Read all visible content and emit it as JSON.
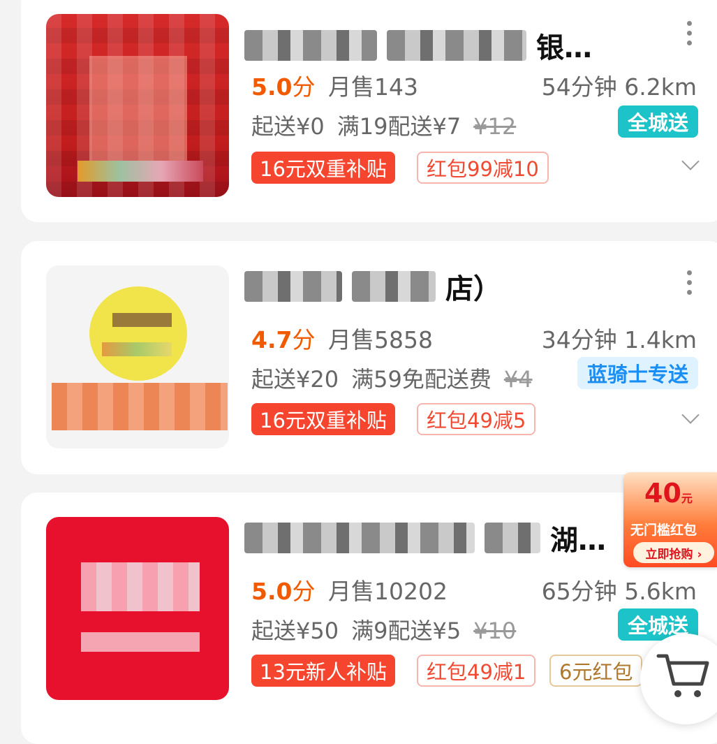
{
  "stores": [
    {
      "name_suffix": "银…",
      "score": "5.0",
      "score_unit": "分",
      "sales": "月售143",
      "time_distance": "54分钟 6.2km",
      "min_order": "起送¥0",
      "delivery_fee": "满19配送¥7",
      "original_fee": "¥12",
      "delivery_tag": "全城送",
      "tags": [
        "16元双重补贴",
        "红包99减10"
      ]
    },
    {
      "name_suffix": "店）",
      "score": "4.7",
      "score_unit": "分",
      "sales": "月售5858",
      "time_distance": "34分钟 1.4km",
      "min_order": "起送¥20",
      "delivery_fee": "满59免配送费",
      "original_fee": "¥4",
      "delivery_tag": "蓝骑士专送",
      "tags": [
        "16元双重补贴",
        "红包49减5"
      ]
    },
    {
      "name_suffix": "湖…",
      "score": "5.0",
      "score_unit": "分",
      "sales": "月售10202",
      "time_distance": "65分钟 5.6km",
      "min_order": "起送¥50",
      "delivery_fee": "满9配送¥5",
      "original_fee": "¥10",
      "delivery_tag": "全城送",
      "tags": [
        "13元新人补贴",
        "红包49减1",
        "6元红包"
      ]
    }
  ],
  "promo": {
    "amount": "40",
    "unit": "元",
    "title": "无门槛红包",
    "button": "立即抢购 ›"
  },
  "colors": {
    "score": "#f25a00",
    "chip_red": "#f6452e",
    "teal_tag": "#1cc3c8",
    "blue_tag": "#1a8ef2"
  }
}
